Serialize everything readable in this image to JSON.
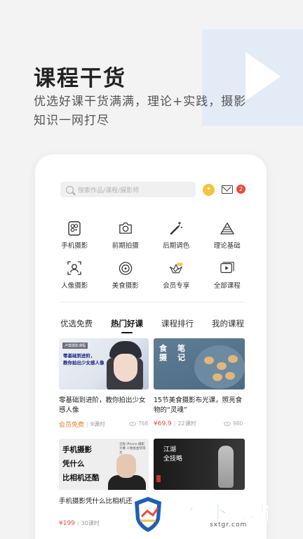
{
  "promo": {
    "headline": "课程干货",
    "subline": "优选好课干货满满，理论+实践，摄影知识一网打尽"
  },
  "search": {
    "placeholder": "搜索作品/课程/摄影师"
  },
  "header": {
    "mail_badge": "2"
  },
  "categories": [
    {
      "label": "手机摄影",
      "icon": "phone-camera-icon"
    },
    {
      "label": "前期拍摄",
      "icon": "camera-icon"
    },
    {
      "label": "后期调色",
      "icon": "magic-wand-icon"
    },
    {
      "label": "理论基础",
      "icon": "pyramid-icon"
    },
    {
      "label": "人像摄影",
      "icon": "portrait-icon"
    },
    {
      "label": "美食摄影",
      "icon": "dish-icon"
    },
    {
      "label": "会员专享",
      "icon": "vip-crown-icon"
    },
    {
      "label": "全部课程",
      "icon": "video-list-icon"
    }
  ],
  "tabs": [
    {
      "label": "优选免费"
    },
    {
      "label": "热门好课",
      "active": true
    },
    {
      "label": "课程排行"
    },
    {
      "label": "我的课程"
    }
  ],
  "courses": [
    {
      "thumb_tag": "卢莫摄影课程",
      "thumb_caption_1": "零基础到进阶，",
      "thumb_caption_2": "教你拍出少女感人像",
      "title": "零基础到进阶，教你拍出少女感人像",
      "price": "会员免费",
      "lessons": "9课时",
      "views": "768"
    },
    {
      "thumb_caption_1": "食",
      "thumb_caption_2": "笔",
      "thumb_caption_3": "摄",
      "thumb_caption_4": "记",
      "title": "15节美食摄影布光课，照亮食物的“灵魂”",
      "price": "¥69.9",
      "lessons": "22课时",
      "views": "980"
    },
    {
      "thumb_caption_1": "手机摄影",
      "thumb_caption_2": "凭什么",
      "thumb_caption_3": "比相机还酷",
      "thumb_small": "全程 iPhone 摄影大赛 人物类金奖得主",
      "title": "手机摄影凭什么比相机还",
      "price": "¥199",
      "lessons": "30课时"
    },
    {
      "thumb_caption_1": "江湖",
      "thumb_caption_2": "全技略",
      "title": ""
    }
  ],
  "watermark": {
    "text": "摄像下载站",
    "url": "sxtgr.com"
  },
  "colors": {
    "accent_orange": "#e67e22",
    "accent_red": "#e74c3c",
    "promo_block": "#e3ebf6",
    "watermark_blue": "#1f5fb5"
  }
}
